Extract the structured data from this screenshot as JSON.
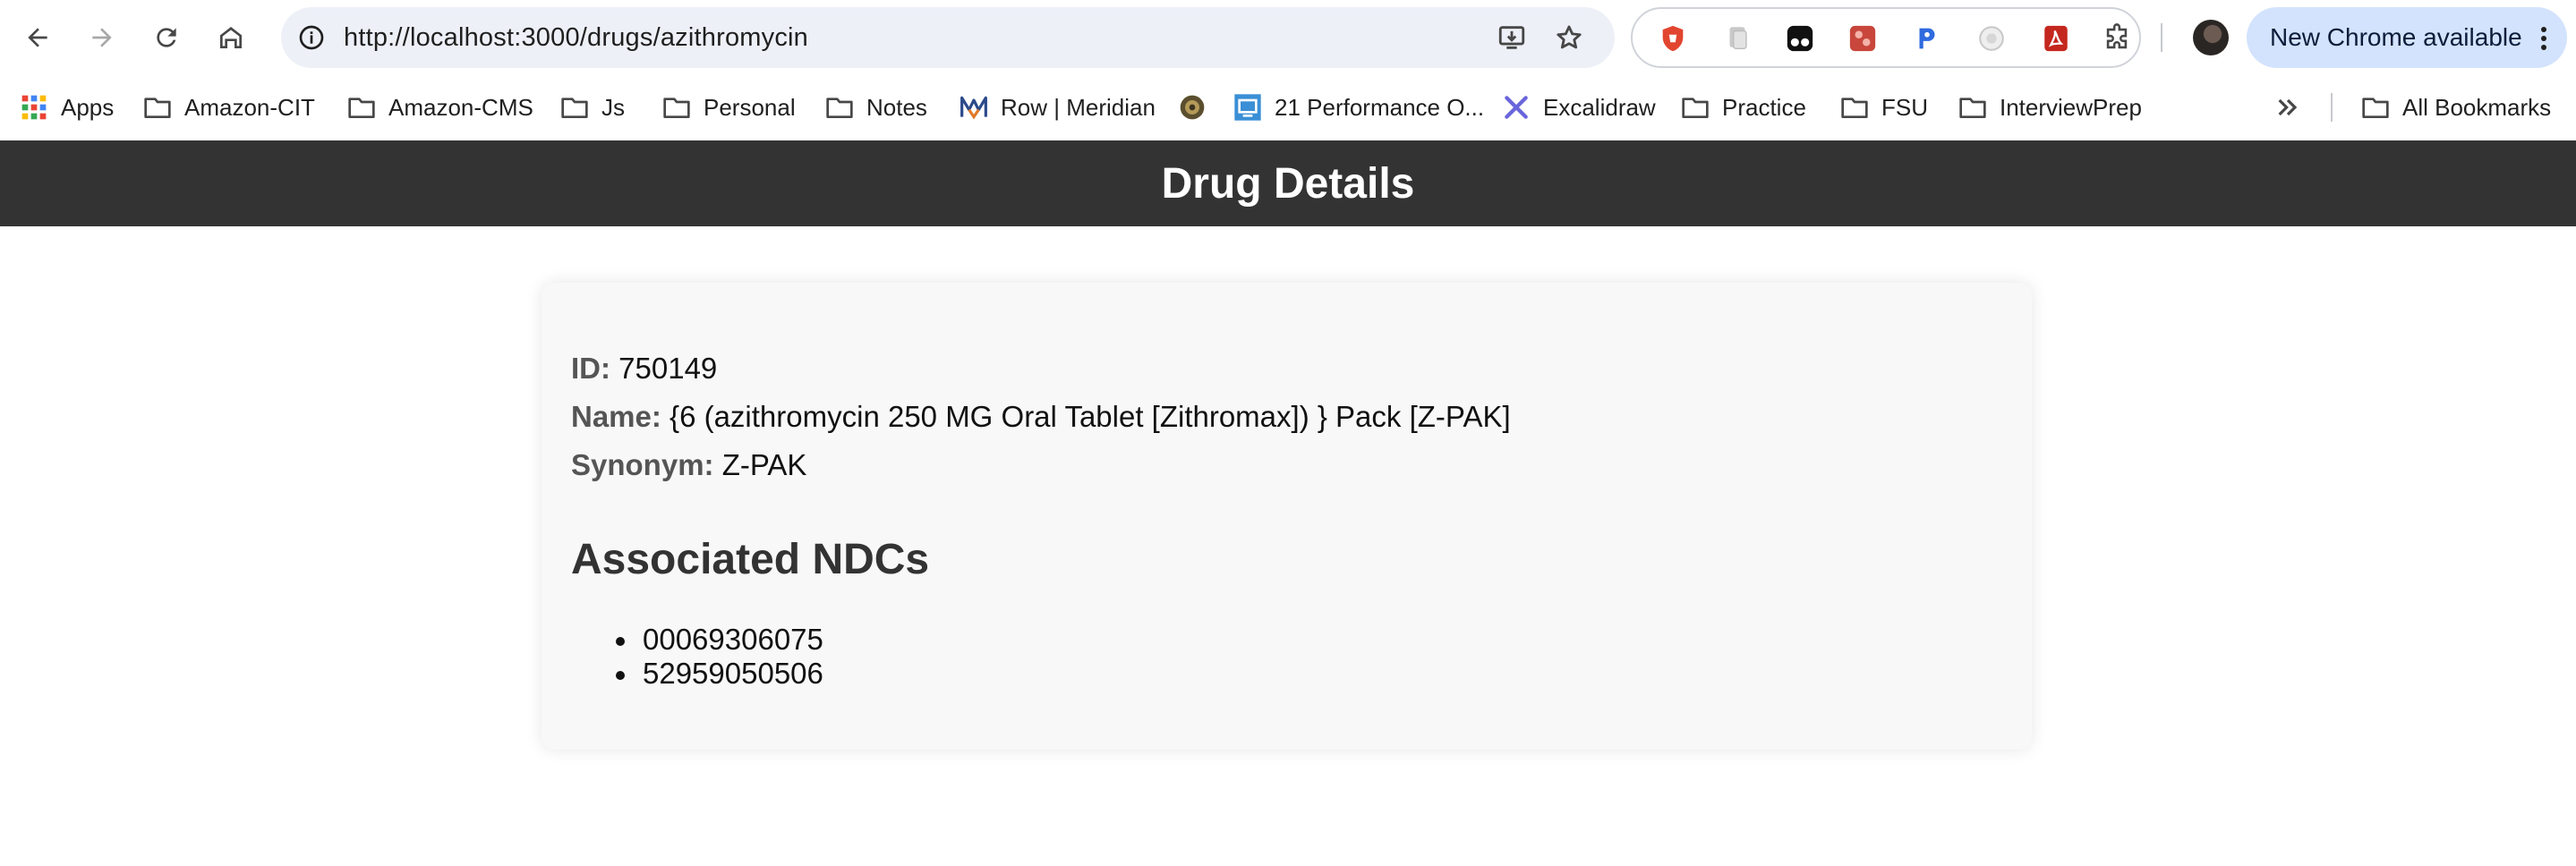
{
  "browser": {
    "url": "http://localhost:3000/drugs/azithromycin",
    "update_label": "New Chrome available",
    "bookmarks": [
      {
        "label": "Apps",
        "icon": "apps-grid-icon"
      },
      {
        "label": "Amazon-CIT",
        "icon": "folder-icon"
      },
      {
        "label": "Amazon-CMS",
        "icon": "folder-icon"
      },
      {
        "label": "Js",
        "icon": "folder-icon"
      },
      {
        "label": "Personal",
        "icon": "folder-icon"
      },
      {
        "label": "Notes",
        "icon": "folder-icon"
      },
      {
        "label": "Row | Meridian",
        "icon": "meridian-logo-icon"
      },
      {
        "label": "",
        "icon": "globe-favicon-icon"
      },
      {
        "label": "21 Performance O...",
        "icon": "performance-favicon-icon"
      },
      {
        "label": "Excalidraw",
        "icon": "excalidraw-icon"
      },
      {
        "label": "Practice",
        "icon": "folder-icon"
      },
      {
        "label": "FSU",
        "icon": "folder-icon"
      },
      {
        "label": "InterviewPrep",
        "icon": "folder-icon"
      }
    ],
    "all_bookmarks_label": "All Bookmarks"
  },
  "page": {
    "header_title": "Drug Details",
    "fields": {
      "id_label": "ID:",
      "id_value": "750149",
      "name_label": "Name:",
      "name_value": "{6 (azithromycin 250 MG Oral Tablet [Zithromax]) } Pack [Z-PAK]",
      "synonym_label": "Synonym:",
      "synonym_value": "Z-PAK"
    },
    "ndc_section_title": "Associated NDCs",
    "ndcs": [
      "00069306075",
      "52959050506"
    ]
  },
  "colors": {
    "header_bg": "#333333",
    "card_bg": "#f8f8f8",
    "omnibox_bg": "#edf0f7",
    "update_pill_bg": "#d3e3fd"
  }
}
